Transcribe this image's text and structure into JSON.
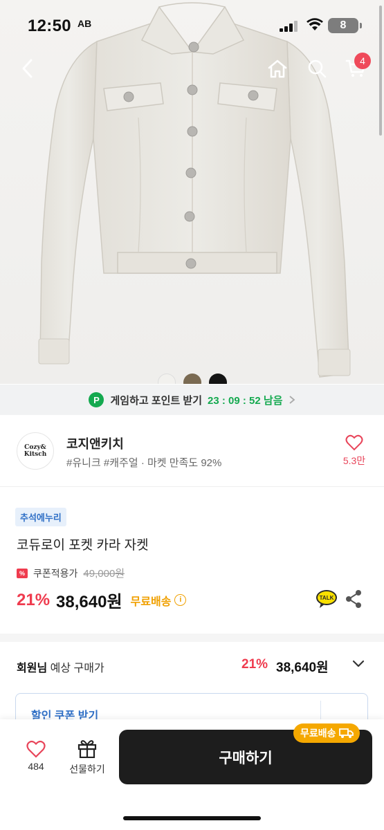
{
  "status_bar": {
    "time": "12:50",
    "carrier": "AB",
    "battery": "8"
  },
  "nav": {
    "cart_count": "4"
  },
  "promo": {
    "text": "게임하고 포인트 받기",
    "timer": "23 : 09 : 52 남음",
    "icon_letter": "P"
  },
  "shop": {
    "logo_line1": "Cozy&",
    "logo_line2": "Kitsch",
    "name": "코지앤키치",
    "tags": "#유니크 #캐주얼 · 마켓 만족도 92%",
    "likes": "5.3만"
  },
  "product": {
    "event_badge": "추석에누리",
    "title": "코듀로이 포켓 카라 자켓",
    "coupon_label": "쿠폰적용가",
    "original_price": "49,000원",
    "discount": "21%",
    "price": "38,640원",
    "free_shipping": "무료배송",
    "swatch_colors": [
      "#f2f1ee",
      "#7a6a52",
      "#141414"
    ]
  },
  "member": {
    "label_bold": "회원님",
    "label_rest": " 예상 구매가",
    "discount": "21%",
    "price": "38,640원"
  },
  "coupon_box": {
    "label": "할인 쿠폰 받기"
  },
  "bottom_bar": {
    "like_count": "484",
    "gift_label": "선물하기",
    "buy_label": "구매하기",
    "free_ship_badge": "무료배송"
  },
  "colors": {
    "accent_red": "#ef3b4e",
    "green": "#14a94f",
    "orange": "#f0a000",
    "blue": "#2f6fc6"
  }
}
